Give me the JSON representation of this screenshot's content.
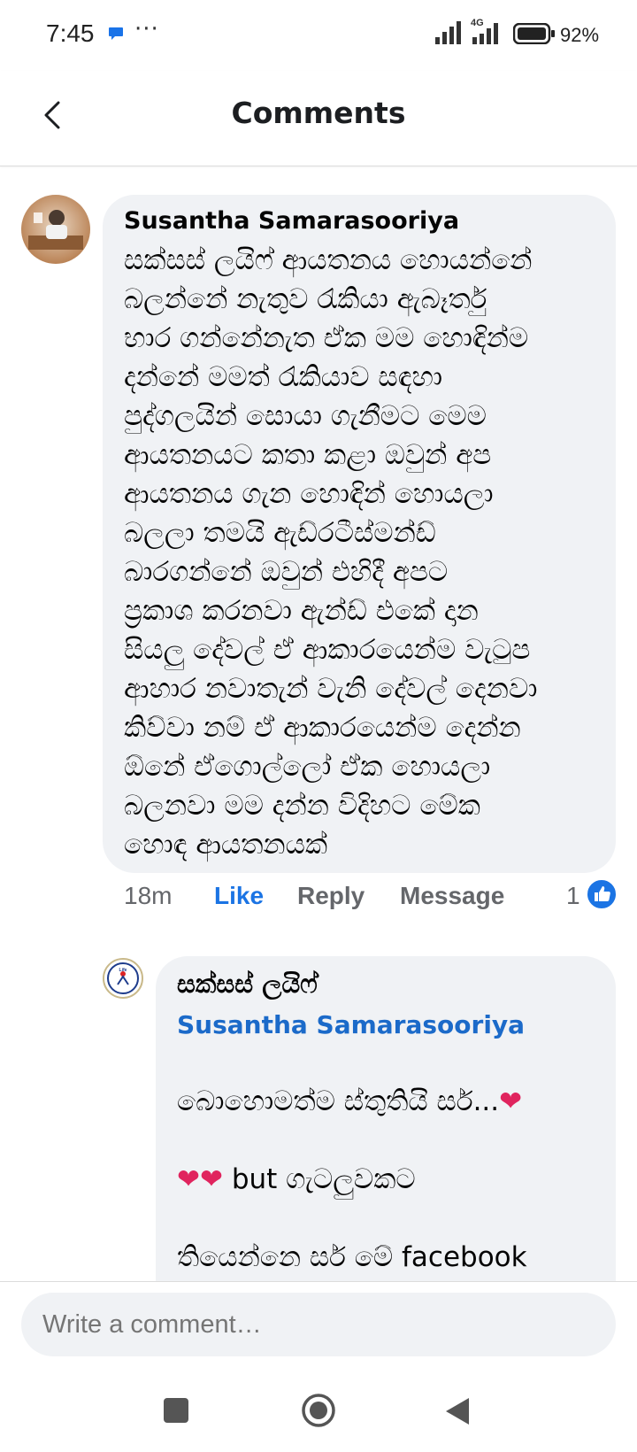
{
  "status_bar": {
    "time": "7:45",
    "more": "···",
    "network": "4G",
    "battery_percent": "92%"
  },
  "header": {
    "title": "Comments",
    "back_icon": "chevron-left-icon"
  },
  "comments": [
    {
      "author": "Susantha Samarasooriya",
      "text": "සක්සස් ලයිෆ් ආයතනය හොයන්නේ\nබලන්නේ නැතුව රැකියා ඇබෑර්තු\nභාර ගන්නේනැත ඒක මම හොඳින්ම\nදන්නේ මමත් රැකියාව සඳහා\nපුද්ගලයින් සොයා ගැනීමට මෙම\nආයතනයට කතා කළා ඔවුන් අප\nආයතනය ගැන හොඳින් හොයලා\nබලලා තමයි ඇඩ්රටීස්මන්ඩ්\nබාරගන්නේ ඔවුන් එහිදී අපට\nප්‍රකාශ කරනවා ඇන්ඩ් එකේ දාන\nසියලු දේවල් ඒ ආකාරයෙන්ම  වැටුප\nආහාර නවාතැන් වැනි දේවල් දෙනවා\nකිව්වා නම් ඒ ආකාරයෙන්ම දෙන්න\nඕනේ ඒගොල්ලෝ ඒක හොයලා\nබලනවා මම දන්න විදිහට මේක\nහොඳ ආයතනයක්",
      "time": "18m",
      "like_label": "Like",
      "reply_label": "Reply",
      "message_label": "Message",
      "reaction_count": "1"
    }
  ],
  "reply": {
    "author": "සක්සස් ලයිෆ්",
    "mention": "Susantha Samarasooriya",
    "text_line1": "බොහොමත්ම ස්තුතියි සර්...",
    "text_line2": " but ගැටලුවකට",
    "text_rest": "තියෙන්නෙ සර් මේ facebook\nName එකෙන් සහ Profile\nPicture එකෙන් අපට\nහඳුනාගැනීමට නොහැකිවීම",
    "heart": "❤",
    "avatar_label": "Life"
  },
  "composer": {
    "placeholder": "Write a comment…"
  },
  "colors": {
    "accent": "#1b74e4",
    "bubble": "#f0f2f5",
    "muted": "#65676b"
  }
}
